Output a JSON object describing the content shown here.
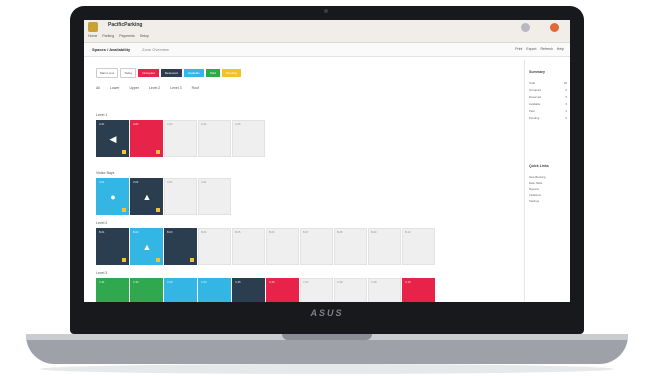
{
  "device": {
    "brand": "ASUS"
  },
  "app": {
    "name": "PacificParking",
    "menu": [
      "Home",
      "Parking",
      "Payments",
      "Setup"
    ],
    "page_title": "Spaces / Availability",
    "page_subtitle": "Zone Overview",
    "actions": [
      "Print",
      "Export",
      "Refresh",
      "Help"
    ]
  },
  "filters": {
    "location": "Main Lot A",
    "period": "Today",
    "chips": [
      {
        "label": "Occupied",
        "color": "#e8234a"
      },
      {
        "label": "Reserved",
        "color": "#2b3e50"
      },
      {
        "label": "Available",
        "color": "#34b6e4"
      },
      {
        "label": "Paid",
        "color": "#2fa84f"
      },
      {
        "label": "Pending",
        "color": "#f2c22e"
      }
    ]
  },
  "tabs": [
    "All",
    "Lower",
    "Upper",
    "Level 2",
    "Level 3",
    "Roof"
  ],
  "sections": [
    {
      "label": "Level 1",
      "tiles": [
        {
          "label": "A-01",
          "color": "#2b3e50",
          "icon": "◀"
        },
        {
          "label": "A-02",
          "color": "#e8234a",
          "icon": ""
        },
        {
          "label": "A-03",
          "color": "",
          "icon": ""
        },
        {
          "label": "A-04",
          "color": "",
          "icon": ""
        },
        {
          "label": "A-05",
          "color": "",
          "icon": ""
        }
      ]
    },
    {
      "label": "Visitor Bays",
      "tiles": [
        {
          "label": "V-01",
          "color": "#34b6e4",
          "icon": "●"
        },
        {
          "label": "V-02",
          "color": "#2b3e50",
          "icon": "▲"
        },
        {
          "label": "V-03",
          "color": "",
          "icon": ""
        },
        {
          "label": "V-04",
          "color": "",
          "icon": ""
        }
      ]
    },
    {
      "label": "Level 2",
      "tiles": [
        {
          "label": "B-01",
          "color": "#2b3e50",
          "icon": ""
        },
        {
          "label": "B-02",
          "color": "#34b6e4",
          "icon": "▲"
        },
        {
          "label": "B-03",
          "color": "#2b3e50",
          "icon": ""
        },
        {
          "label": "B-04",
          "color": "",
          "icon": ""
        },
        {
          "label": "B-05",
          "color": "",
          "icon": ""
        },
        {
          "label": "B-06",
          "color": "",
          "icon": ""
        },
        {
          "label": "B-07",
          "color": "",
          "icon": ""
        },
        {
          "label": "B-08",
          "color": "",
          "icon": ""
        },
        {
          "label": "B-09",
          "color": "",
          "icon": ""
        },
        {
          "label": "B-10",
          "color": "",
          "icon": ""
        }
      ]
    },
    {
      "label": "Level 3",
      "tiles": [
        {
          "label": "C-01",
          "color": "#2fa84f",
          "icon": ""
        },
        {
          "label": "C-02",
          "color": "#2fa84f",
          "icon": ""
        },
        {
          "label": "C-03",
          "color": "#34b6e4",
          "icon": ""
        },
        {
          "label": "C-04",
          "color": "#34b6e4",
          "icon": ""
        },
        {
          "label": "C-05",
          "color": "#2b3e50",
          "icon": ""
        },
        {
          "label": "C-06",
          "color": "#e8234a",
          "icon": ""
        },
        {
          "label": "C-07",
          "color": "",
          "icon": ""
        },
        {
          "label": "C-08",
          "color": "",
          "icon": ""
        },
        {
          "label": "C-09",
          "color": "",
          "icon": ""
        },
        {
          "label": "C-10",
          "color": "#e8234a",
          "icon": ""
        }
      ]
    }
  ],
  "side": {
    "heading": "Summary",
    "rows": [
      {
        "k": "Total",
        "v": "29"
      },
      {
        "k": "Occupied",
        "v": "6"
      },
      {
        "k": "Reserved",
        "v": "5"
      },
      {
        "k": "Available",
        "v": "6"
      },
      {
        "k": "Paid",
        "v": "2"
      },
      {
        "k": "Pending",
        "v": "0"
      }
    ],
    "heading2": "Quick Links",
    "links": [
      "New Booking",
      "Rate Table",
      "Reports",
      "Violations",
      "Settings"
    ]
  }
}
